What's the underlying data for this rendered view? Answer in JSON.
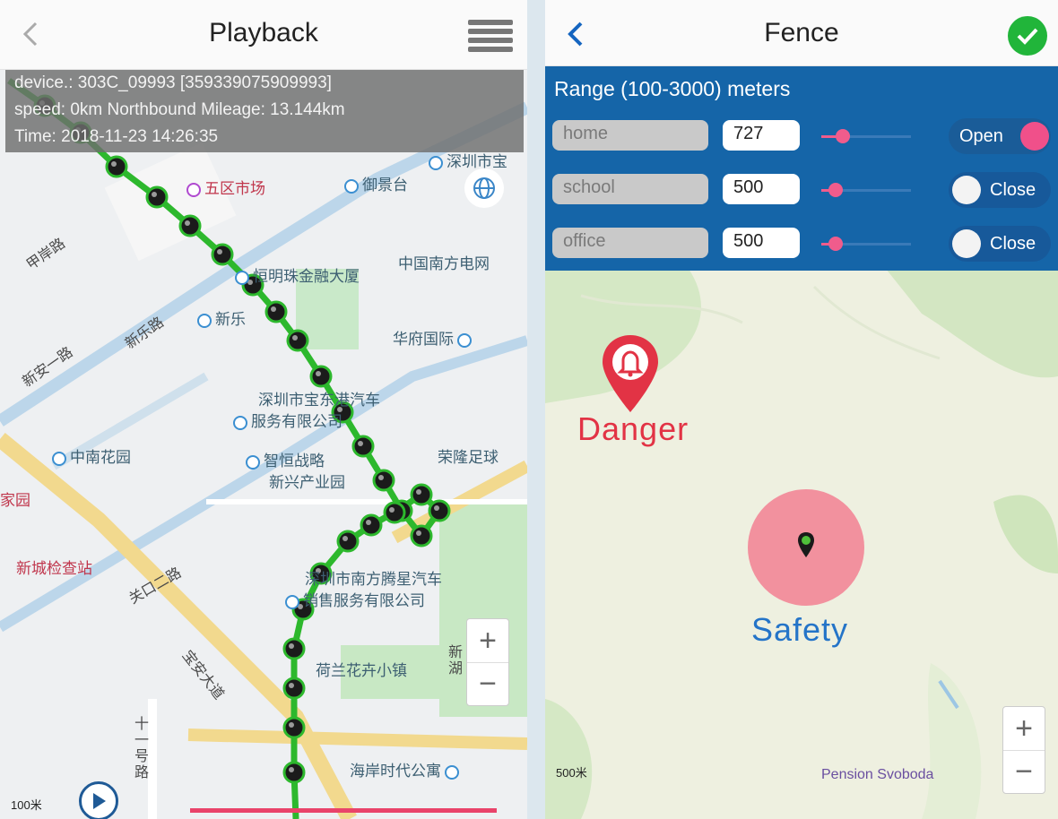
{
  "playback": {
    "title": "Playback",
    "info": {
      "device": "device.: 303C_09993 [359339075909993]",
      "speed": "speed: 0km Northbound Mileage: 13.144km",
      "time": "Time: 2018-11-23 14:26:35"
    },
    "map_labels": {
      "wuqu": "五区市场",
      "yuyingtai": "御景台",
      "shenzhen_s": "深圳市宝",
      "xingming": "恒明珠金融大厦",
      "nanfang": "中国南方电网",
      "xinle": "新乐路",
      "xinxiang": "新乐",
      "huafu": "华府国际",
      "shenzhen_car": "深圳市宝东港汽车",
      "service": "服务有限公司",
      "zhongnan": "中南花园",
      "zhiheng": "智恒战略",
      "xinxing": "新兴产业园",
      "ronglong": "荣隆足球",
      "xincheng": "新城检查站",
      "shenzhen_nf": "深圳市南方腾星汽车",
      "nf_service": "销售服务有限公司",
      "helan": "荷兰花卉小镇",
      "haian": "海岸时代公寓",
      "xinan_rd": "新安一路",
      "guankou": "关口二路",
      "baoan": "宝安大道",
      "shiyi": "十一号路",
      "jiayuan": "家园",
      "jiayuan_rd": "甲岸路",
      "xinghai": "新湖"
    },
    "zoom_in": "+",
    "zoom_out": "−",
    "scale": "100米",
    "progress": 0.58
  },
  "fence": {
    "title": "Fence",
    "range_label": "Range (100-3000) meters",
    "rows": [
      {
        "name": "home",
        "value": "727",
        "slider": 0.24,
        "state": "Open",
        "on": true
      },
      {
        "name": "school",
        "value": "500",
        "slider": 0.16,
        "state": "Close",
        "on": false
      },
      {
        "name": "office",
        "value": "500",
        "slider": 0.16,
        "state": "Close",
        "on": false
      }
    ],
    "danger": "Danger",
    "safety": "Safety",
    "poi": "Pension Svoboda",
    "scale": "500米",
    "zoom_in": "+",
    "zoom_out": "−"
  },
  "colors": {
    "track": "#2db82d",
    "panel": "#1565a8",
    "accent_pink": "#f05c8c",
    "check": "#21b53a",
    "danger": "#e23345",
    "safety": "#2474c8"
  }
}
